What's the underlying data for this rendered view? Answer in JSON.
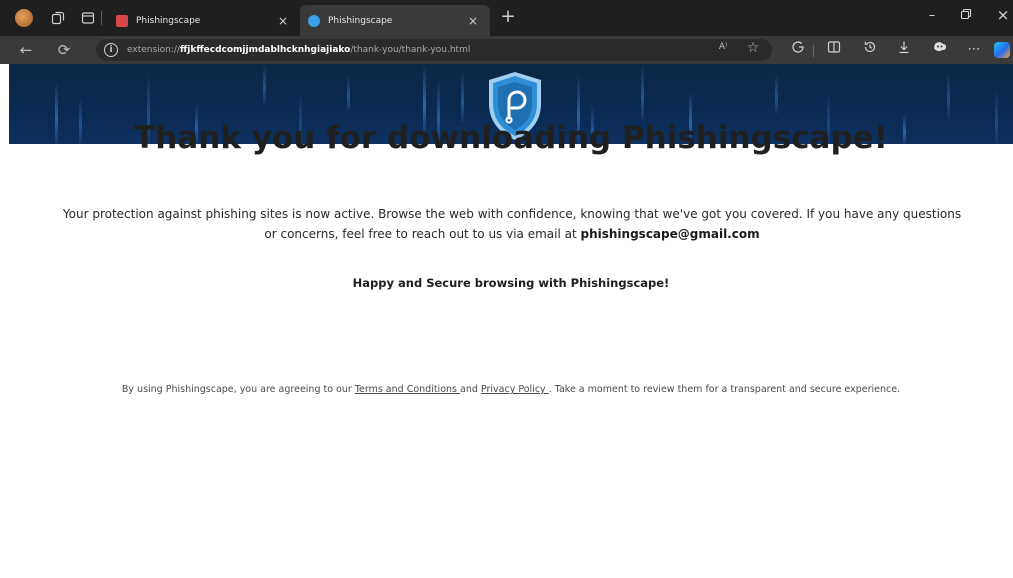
{
  "browser": {
    "tabs": [
      {
        "title": "Phishingscape",
        "favicon_color": "#e55050",
        "active": false
      },
      {
        "title": "Phishingscape",
        "favicon_color": "#3aa0e8",
        "active": true
      }
    ],
    "tab_close_glyph": "×",
    "new_tab_glyph": "+",
    "window_controls": {
      "minimize": "–",
      "restore": "ᗜ",
      "close": "×"
    },
    "address": {
      "scheme": "extension://",
      "host": "ffjkffecdcomjjmdablhcknhgiajiako",
      "path": "/thank-you/thank-you.html"
    },
    "read_aloud_label": "A⁾"
  },
  "page": {
    "heading": "Thank you for downloading Phishingscape!",
    "intro_text": "Your protection against phishing sites is now active. Browse the web with confidence, knowing that we've got you covered. If you have any questions or concerns, feel free to reach out to us via email at ",
    "email": "phishingscape@gmail.com",
    "happy_text": "Happy and Secure browsing with Phishingscape!",
    "terms": {
      "prefix": "By using Phishingscape, you are agreeing to our ",
      "terms_link": "Terms and Conditions ",
      "middle": "and ",
      "privacy_link": "Privacy Policy ",
      "suffix": ". Take a moment to review them for a transparent and secure experience."
    }
  },
  "colors": {
    "banner": "#0a2a52",
    "logo_shield": "#2f8fd6",
    "chrome_dark": "#1f1f1f",
    "chrome_toolbar": "#3a3a3a"
  }
}
